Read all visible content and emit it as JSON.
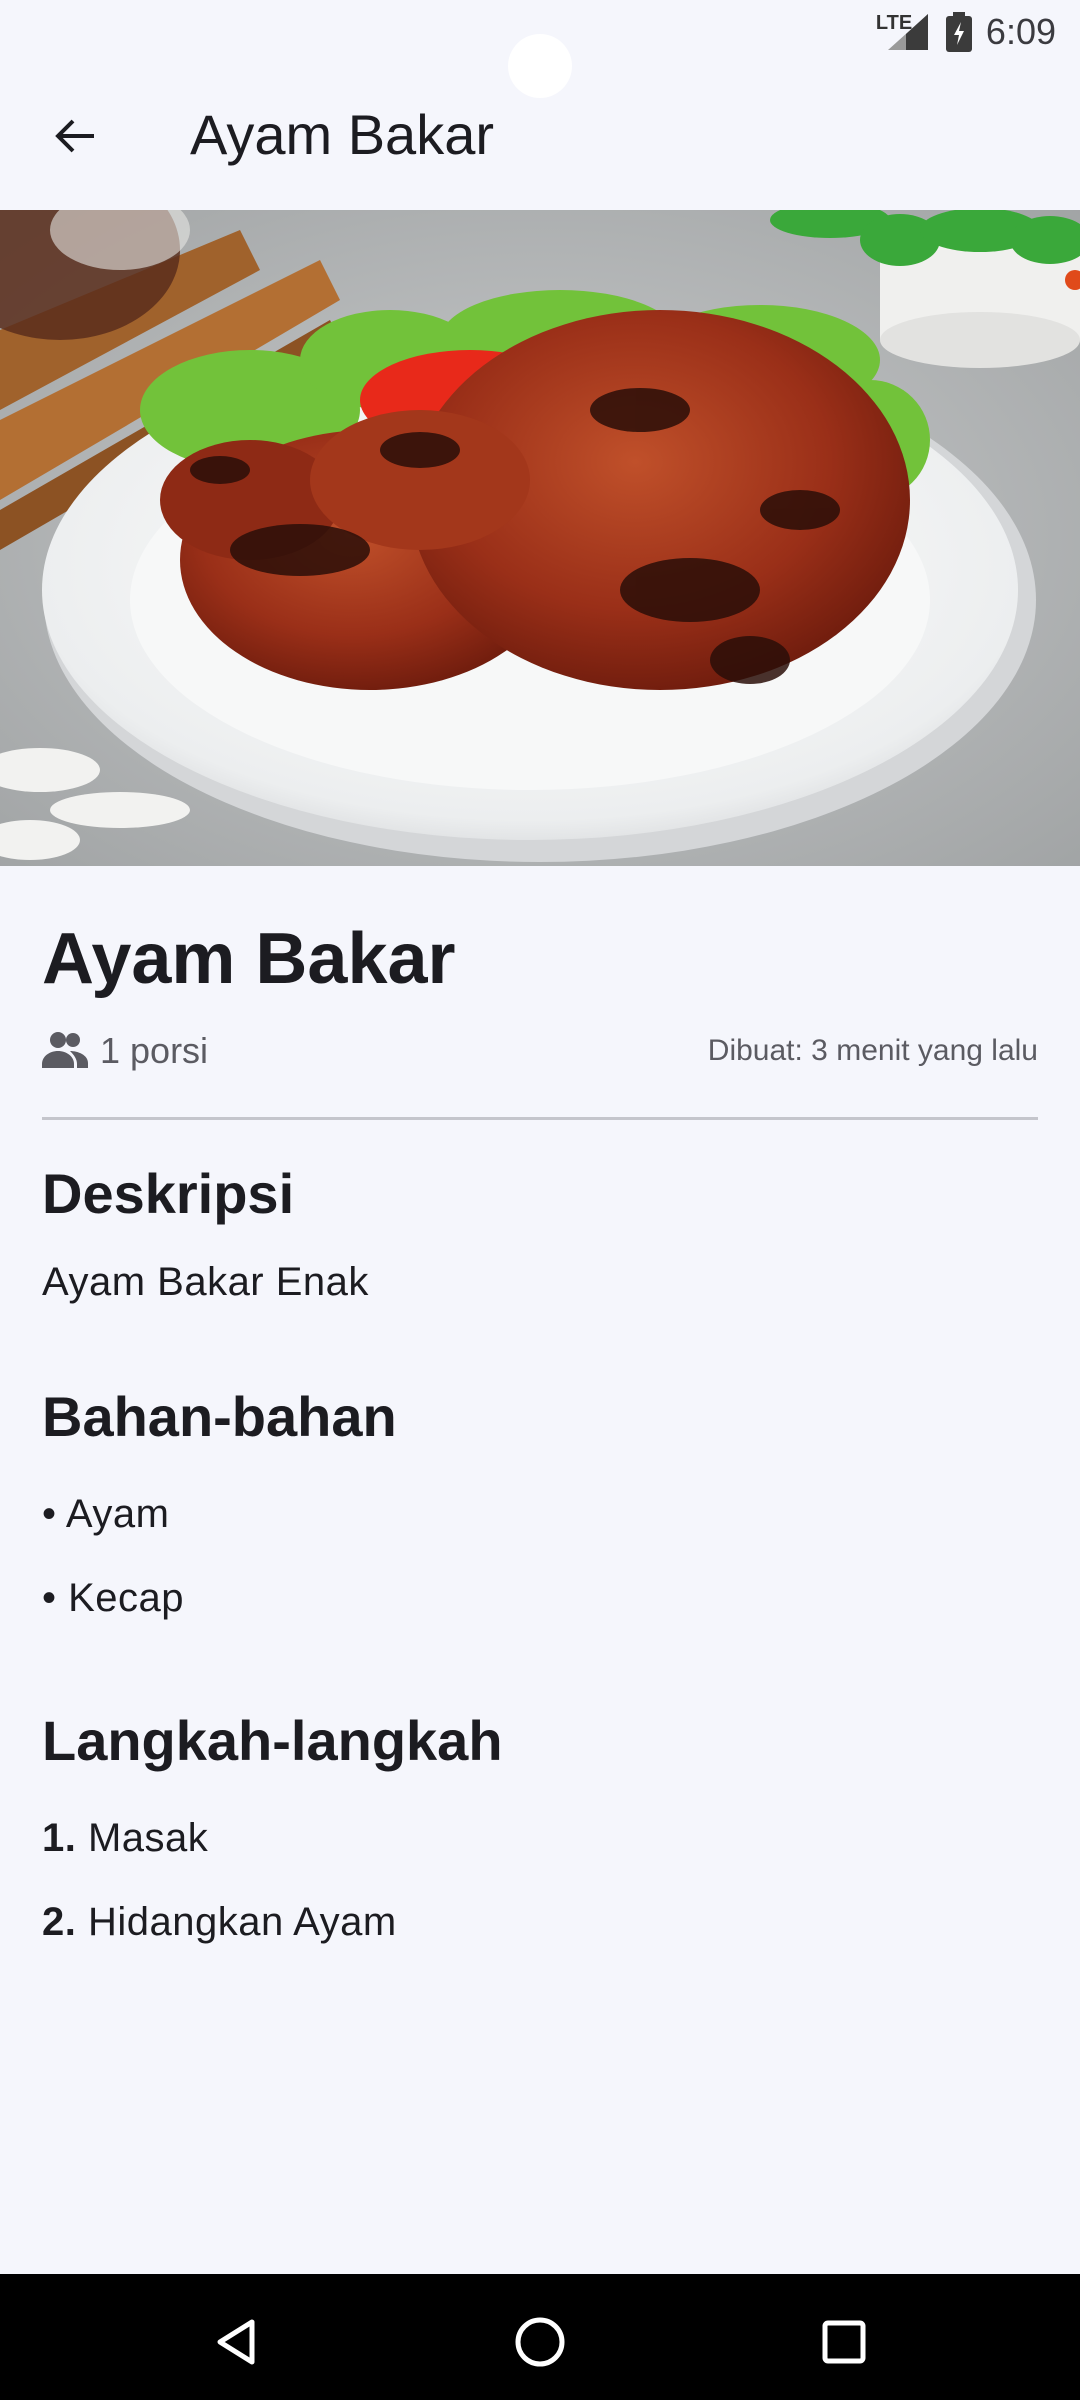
{
  "status_bar": {
    "network": "LTE",
    "time": "6:09"
  },
  "app_bar": {
    "title": "Ayam Bakar",
    "back_icon": "arrow-left-icon"
  },
  "hero_image": {
    "subject": "ayam-bakar-photo"
  },
  "recipe": {
    "title": "Ayam Bakar",
    "portion": "1 porsi",
    "created": "Dibuat: 3 menit yang lalu",
    "description_heading": "Deskripsi",
    "description": "Ayam Bakar Enak",
    "ingredients_heading": "Bahan-bahan",
    "ingredients": [
      "• Ayam",
      "• Kecap"
    ],
    "steps_heading": "Langkah-langkah",
    "steps": [
      {
        "num": "1.",
        "text": "Masak"
      },
      {
        "num": "2.",
        "text": "Hidangkan Ayam"
      }
    ]
  },
  "colors": {
    "background": "#f5f6fc",
    "text": "#1c1c21",
    "muted": "#5b5b62"
  }
}
